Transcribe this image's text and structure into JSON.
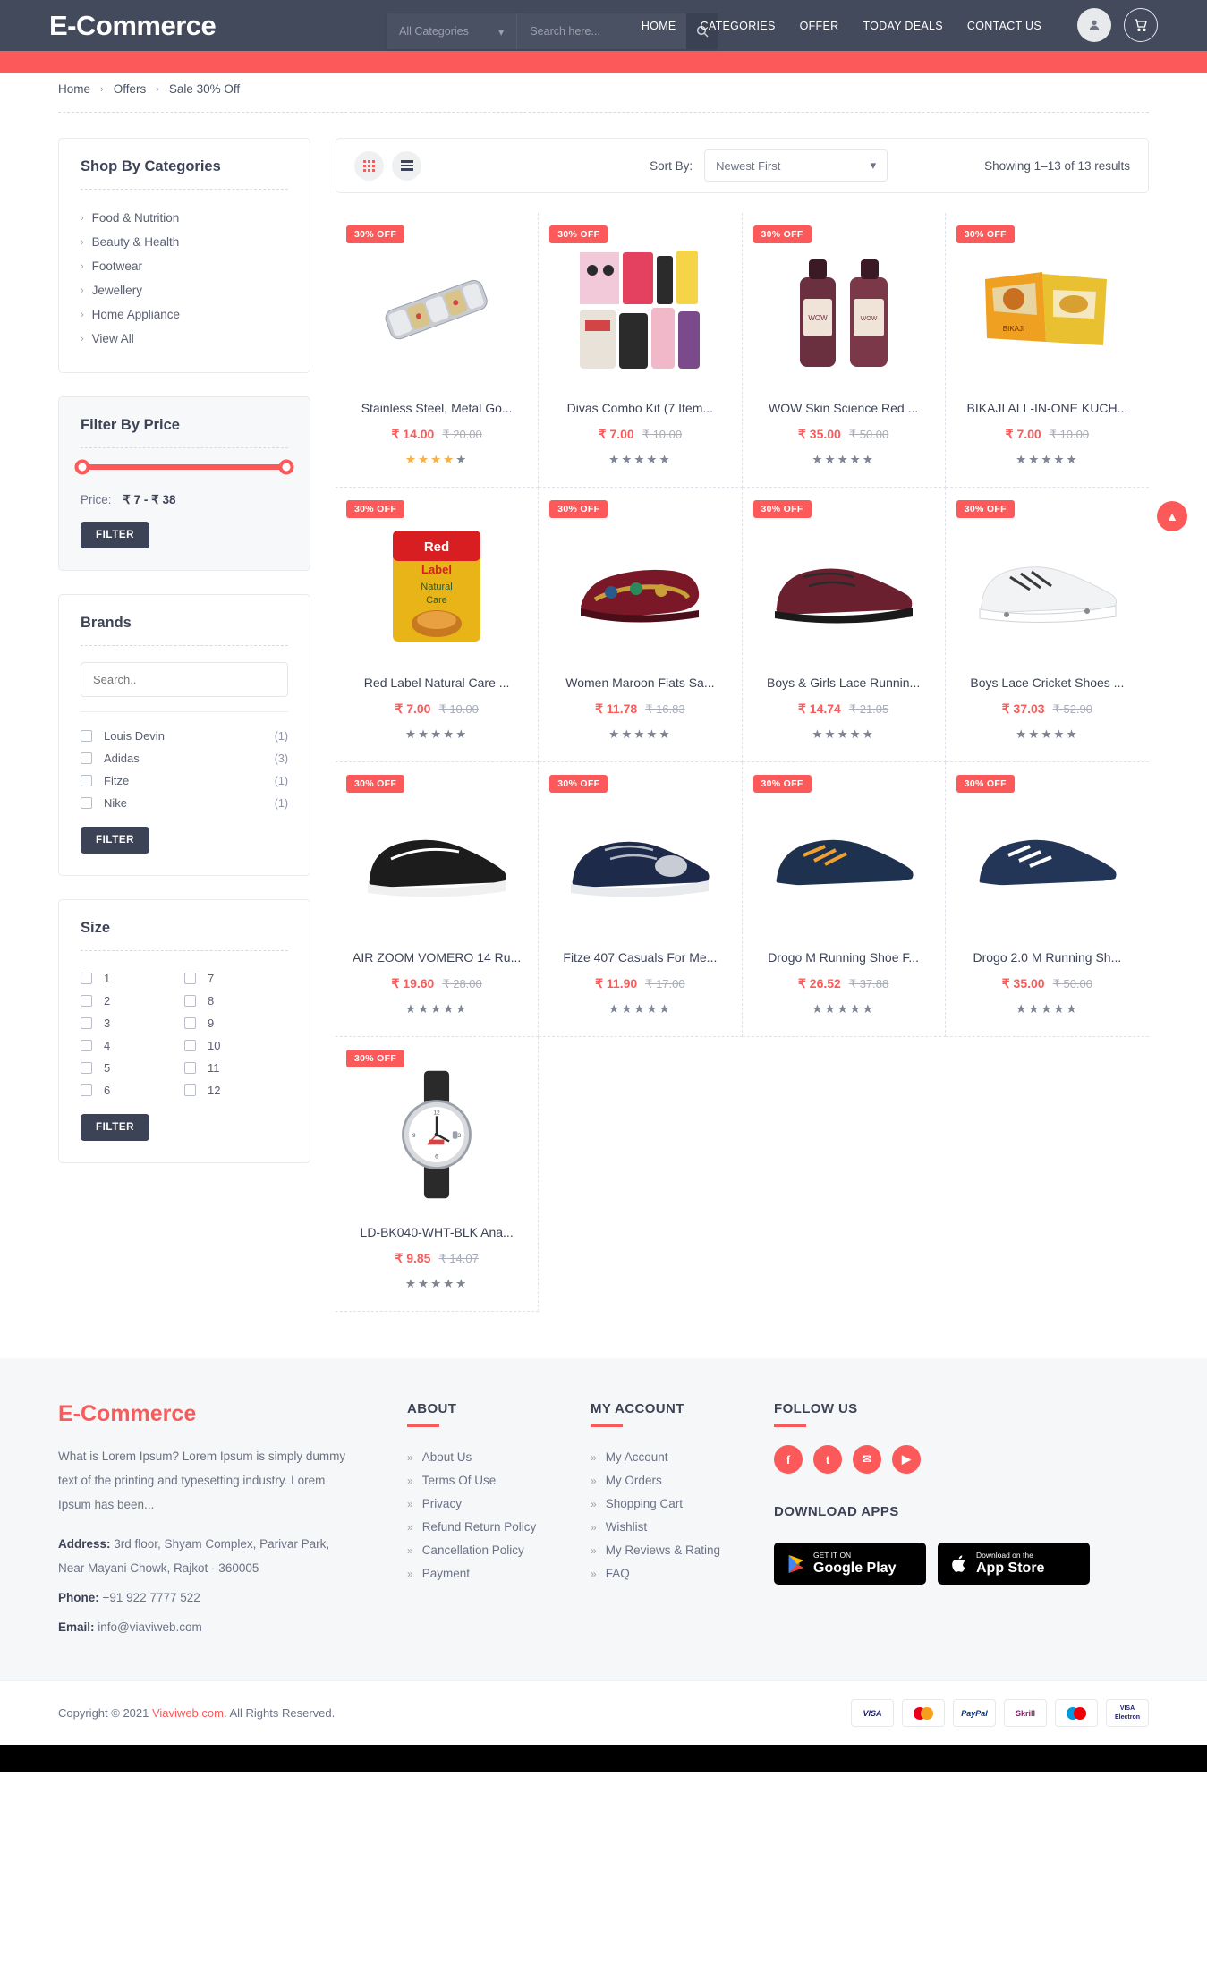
{
  "header": {
    "brand": "E-Commerce",
    "category_select": "All Categories",
    "search_placeholder": "Search here...",
    "search_icon": "search-icon",
    "nav": [
      {
        "label": "HOME"
      },
      {
        "label": "CATEGORIES"
      },
      {
        "label": "OFFER"
      },
      {
        "label": "TODAY DEALS"
      },
      {
        "label": "CONTACT US"
      }
    ],
    "icons": [
      {
        "name": "user-account-icon",
        "glyph": "●"
      },
      {
        "name": "shopping-cart-icon",
        "glyph": "●"
      }
    ],
    "accent_color": "#fc5a5a",
    "bar_color": "#434a5c"
  },
  "breadcrumb": {
    "items": [
      "Home",
      "Offers",
      "Sale 30% Off"
    ],
    "separator": "›"
  },
  "sidebar": {
    "categories": {
      "title": "Shop By Categories",
      "items": [
        {
          "label": "Food & Nutrition"
        },
        {
          "label": "Beauty & Health"
        },
        {
          "label": "Footwear"
        },
        {
          "label": "Jewellery"
        },
        {
          "label": "Home Appliance"
        },
        {
          "label": "View All"
        }
      ]
    },
    "price_filter": {
      "title": "Filter By Price",
      "price_label": "Price:",
      "price_range": "₹ 7 - ₹ 38",
      "min": 7,
      "max": 38,
      "button": "FILTER"
    },
    "brands": {
      "title": "Brands",
      "search_placeholder": "Search..",
      "items": [
        {
          "label": "Louis Devin",
          "count": "(1)"
        },
        {
          "label": "Adidas",
          "count": "(3)"
        },
        {
          "label": "Fitze",
          "count": "(1)"
        },
        {
          "label": "Nike",
          "count": "(1)"
        }
      ],
      "button": "FILTER"
    },
    "size": {
      "title": "Size",
      "left": [
        "1",
        "2",
        "3",
        "4",
        "5",
        "6"
      ],
      "right": [
        "7",
        "8",
        "9",
        "10",
        "11",
        "12"
      ],
      "button": "FILTER"
    }
  },
  "toolbar": {
    "grid_icon": "grid-view-icon",
    "list_icon": "list-view-icon",
    "sort_label": "Sort By:",
    "sort_value": "Newest First",
    "results": "Showing 1–13 of 13 results"
  },
  "products": [
    {
      "name": "Stainless Steel, Metal Go...",
      "badge": "30% OFF",
      "price": "₹ 14.00",
      "old": "₹ 20.00",
      "rating": 4,
      "img": "bracelet"
    },
    {
      "name": "Divas Combo Kit (7 Item...",
      "badge": "30% OFF",
      "price": "₹ 7.00",
      "old": "₹ 10.00",
      "rating": 0,
      "img": "cosmetics"
    },
    {
      "name": "WOW Skin Science Red ...",
      "badge": "30% OFF",
      "price": "₹ 35.00",
      "old": "₹ 50.00",
      "rating": 0,
      "img": "shampoo"
    },
    {
      "name": "BIKAJI ALL-IN-ONE KUCH...",
      "badge": "30% OFF",
      "price": "₹ 7.00",
      "old": "₹ 10.00",
      "rating": 0,
      "img": "snacks"
    },
    {
      "name": "Red Label Natural Care ...",
      "badge": "30% OFF",
      "price": "₹ 7.00",
      "old": "₹ 10.00",
      "rating": 0,
      "img": "teapack"
    },
    {
      "name": "Women Maroon Flats Sa...",
      "badge": "30% OFF",
      "price": "₹ 11.78",
      "old": "₹ 16.83",
      "rating": 0,
      "img": "sandal"
    },
    {
      "name": "Boys & Girls Lace Runnin...",
      "badge": "30% OFF",
      "price": "₹ 14.74",
      "old": "₹ 21.05",
      "rating": 0,
      "img": "maroonshoe"
    },
    {
      "name": "Boys Lace Cricket Shoes ...",
      "badge": "30% OFF",
      "price": "₹ 37.03",
      "old": "₹ 52.90",
      "rating": 0,
      "img": "whiteshoe"
    },
    {
      "name": "AIR ZOOM VOMERO 14 Ru...",
      "badge": "30% OFF",
      "price": "₹ 19.60",
      "old": "₹ 28.00",
      "rating": 0,
      "img": "blackshoe"
    },
    {
      "name": "Fitze 407 Casuals For Me...",
      "badge": "30% OFF",
      "price": "₹ 11.90",
      "old": "₹ 17.00",
      "rating": 0,
      "img": "navyshoe"
    },
    {
      "name": "Drogo M Running Shoe F...",
      "badge": "30% OFF",
      "price": "₹ 26.52",
      "old": "₹ 37.88",
      "rating": 0,
      "img": "bluesneaker"
    },
    {
      "name": "Drogo 2.0 M Running Sh...",
      "badge": "30% OFF",
      "price": "₹ 35.00",
      "old": "₹ 50.00",
      "rating": 0,
      "img": "navysneaker"
    },
    {
      "name": "LD-BK040-WHT-BLK Ana...",
      "badge": "30% OFF",
      "price": "₹ 9.85",
      "old": "₹ 14.07",
      "rating": 0,
      "img": "watch"
    }
  ],
  "scroll_top_icon": "scroll-to-top-icon",
  "footer": {
    "brand": "E-Commerce",
    "description": "What is Lorem Ipsum? Lorem Ipsum is simply dummy text of the printing and typesetting industry. Lorem Ipsum has been...",
    "address_label": "Address:",
    "address": "3rd floor, Shyam Complex, Parivar Park, Near Mayani Chowk, Rajkot - 360005",
    "phone_label": "Phone:",
    "phone": "+91 922 7777 522",
    "email_label": "Email:",
    "email": "info@viaviweb.com",
    "about": {
      "title": "ABOUT",
      "links": [
        "About Us",
        "Terms Of Use",
        "Privacy",
        "Refund Return Policy",
        "Cancellation Policy",
        "Payment"
      ]
    },
    "account": {
      "title": "MY ACCOUNT",
      "links": [
        "My Account",
        "My Orders",
        "Shopping Cart",
        "Wishlist",
        "My Reviews & Rating",
        "FAQ"
      ]
    },
    "follow": {
      "title": "FOLLOW US",
      "socials": [
        {
          "name": "facebook-icon",
          "glyph": "f"
        },
        {
          "name": "twitter-icon",
          "glyph": "t"
        },
        {
          "name": "email-icon",
          "glyph": "✉"
        },
        {
          "name": "youtube-icon",
          "glyph": "▶"
        }
      ]
    },
    "apps": {
      "title": "DOWNLOAD APPS",
      "google": {
        "small": "GET IT ON",
        "big": "Google Play",
        "icon": "google-play-icon"
      },
      "apple": {
        "small": "Download on the",
        "big": "App Store",
        "icon": "apple-icon"
      }
    }
  },
  "copyright": {
    "prefix": "Copyright © 2021 ",
    "link": "Viaviweb.com",
    "suffix": ". All Rights Reserved.",
    "cards": [
      "VISA",
      "MasterCard",
      "PayPal",
      "Skrill",
      "Maestro",
      "VISA Electron"
    ]
  }
}
